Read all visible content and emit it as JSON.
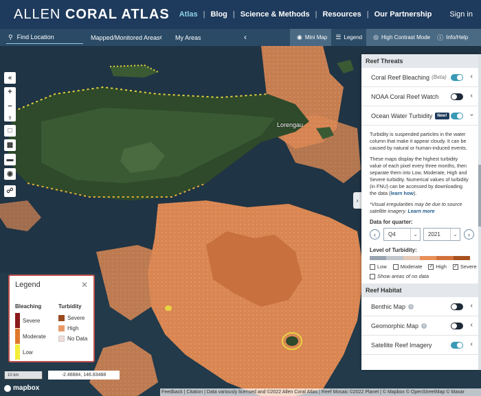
{
  "brand": {
    "light": "ALLEN ",
    "bold": "CORAL ATLAS"
  },
  "nav": {
    "links": [
      "Atlas",
      "Blog",
      "Science & Methods",
      "Resources",
      "Our Partnership"
    ],
    "signin": "Sign in"
  },
  "toolbar": {
    "find_location": "Find Location",
    "mapped_areas": "Mapped/Monitored Areas",
    "my_areas": "My Areas",
    "mini_map": "Mini Map",
    "legend": "Legend",
    "high_contrast": "High Contrast Mode",
    "info_help": "Info/Help"
  },
  "map": {
    "place_label": "Lorengau",
    "zoom_level": "9",
    "scale": "10 km",
    "coords": "-2.48884, 146.83488",
    "mapbox": "mapbox",
    "attribution": "Feedback | Citation | Data variously licensed and ©2022 Allen Coral Atlas | Reef Mosaic ©2022 Planet | © Mapbox © OpenStreetMap © Maxar"
  },
  "legend": {
    "title": "Legend",
    "bleaching_heading": "Bleaching",
    "turbidity_heading": "Turbidity",
    "bleaching_levels": [
      "Severe",
      "Moderate",
      "Low"
    ],
    "turbidity_levels": [
      "Severe",
      "High",
      "No Data"
    ],
    "colors": {
      "bleach_severe": "#8b1a1a",
      "bleach_moderate": "#e07a2a",
      "bleach_low": "#f4ee3a",
      "turb_severe": "#9a4a1e",
      "turb_high": "#e89a68",
      "turb_nodata": "#f0dcd8"
    }
  },
  "panel": {
    "reef_threats": "Reef Threats",
    "rows": [
      {
        "label": "Coral Reef Bleaching",
        "tag": "(Beta)",
        "on": true
      },
      {
        "label": "NOAA Coral Reef Watch",
        "on": false
      },
      {
        "label": "Ocean Water Turbidity",
        "tag": "New!",
        "on": true
      }
    ],
    "desc1": "Turbidity is suspended particles in the water column that make it appear cloudy. It can be caused by natural or human-induced events.",
    "desc2a": "These maps display the highest turbidity value of each pixel every three months, then separate them into Low, Moderate, High and Severe turbidity. Numerical values of turbidity (in FNU) can be accessed by downloading the data (",
    "desc2_link": "learn how",
    "desc2b": ").",
    "note": "*Visual irregularities may be due to source satellite imagery.",
    "note_link": "Learn more",
    "quarter_label": "Data for quarter:",
    "quarter": "Q4",
    "year": "2021",
    "turbidity_label": "Level of Turbidity:",
    "turb_colors": [
      "#9aa4b0",
      "#c0c6cc",
      "#e4c8b8",
      "#e8905a",
      "#d0703a",
      "#a8501e"
    ],
    "levels": [
      {
        "label": "Low",
        "checked": false
      },
      {
        "label": "Moderate",
        "checked": false
      },
      {
        "label": "High",
        "checked": true
      },
      {
        "label": "Severe",
        "checked": true
      }
    ],
    "no_data": "Show areas of no data",
    "reef_habitat": "Reef Habitat",
    "habitat_rows": [
      {
        "label": "Benthic Map",
        "on": false
      },
      {
        "label": "Geomorphic Map",
        "on": false
      },
      {
        "label": "Satellite Reef Imagery",
        "on": true
      }
    ]
  }
}
